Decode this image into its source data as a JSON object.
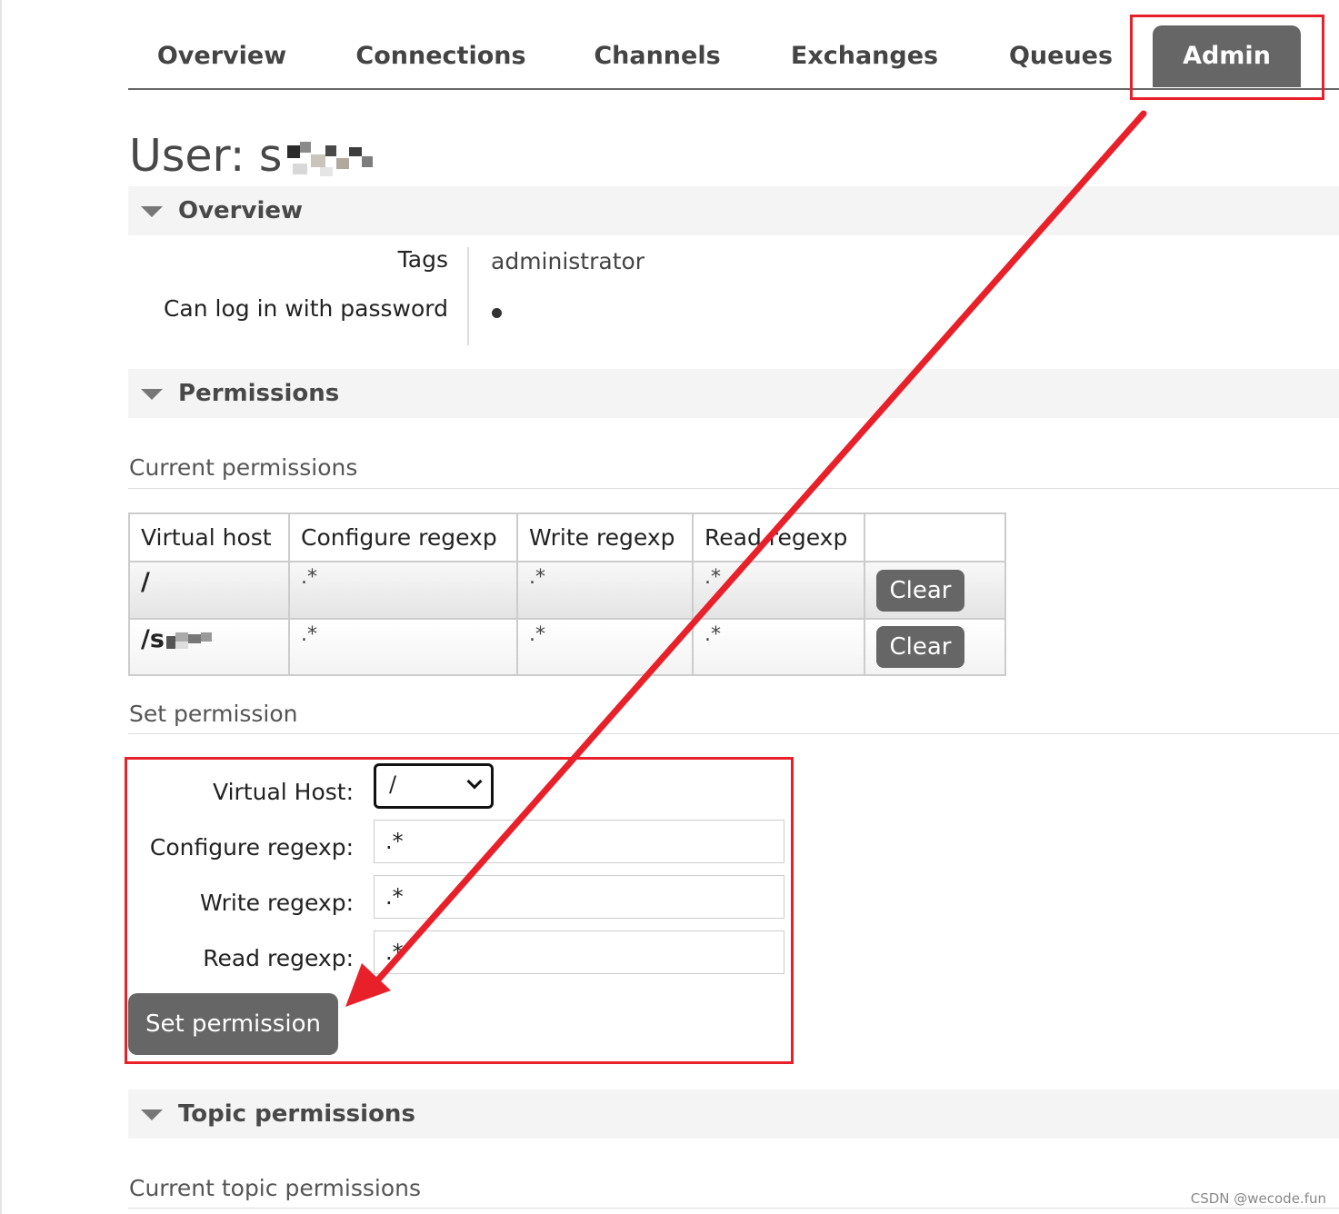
{
  "nav": {
    "tabs": [
      {
        "label": "Overview",
        "active": false
      },
      {
        "label": "Connections",
        "active": false
      },
      {
        "label": "Channels",
        "active": false
      },
      {
        "label": "Exchanges",
        "active": false
      },
      {
        "label": "Queues",
        "active": false
      },
      {
        "label": "Admin",
        "active": true
      }
    ]
  },
  "page": {
    "title_prefix": "User: s",
    "username_note": "pixelated"
  },
  "overview": {
    "header": "Overview",
    "tags_label": "Tags",
    "tags_value": "administrator",
    "password_label": "Can log in with password",
    "password_value": "•"
  },
  "permissions": {
    "header": "Permissions",
    "current_heading": "Current permissions",
    "columns": [
      "Virtual host",
      "Configure regexp",
      "Write regexp",
      "Read regexp",
      ""
    ],
    "rows": [
      {
        "vhost": "/",
        "configure": ".*",
        "write": ".*",
        "read": ".*",
        "action": "Clear"
      },
      {
        "vhost": "/s",
        "configure": ".*",
        "write": ".*",
        "read": ".*",
        "action": "Clear"
      }
    ],
    "set_heading": "Set permission",
    "form": {
      "vhost_label": "Virtual Host:",
      "vhost_selected": "/",
      "configure_label": "Configure regexp:",
      "configure_value": ".*",
      "write_label": "Write regexp:",
      "write_value": ".*",
      "read_label": "Read regexp:",
      "read_value": ".*",
      "submit_label": "Set permission"
    }
  },
  "topic_permissions": {
    "header": "Topic permissions",
    "current_heading": "Current topic permissions"
  },
  "annotation": {
    "color": "#e8202a"
  },
  "colors": {
    "tab_active_bg": "#666666",
    "button_bg": "#666666",
    "section_bg": "#f4f4f4"
  },
  "watermark": "CSDN @wecode.fun"
}
